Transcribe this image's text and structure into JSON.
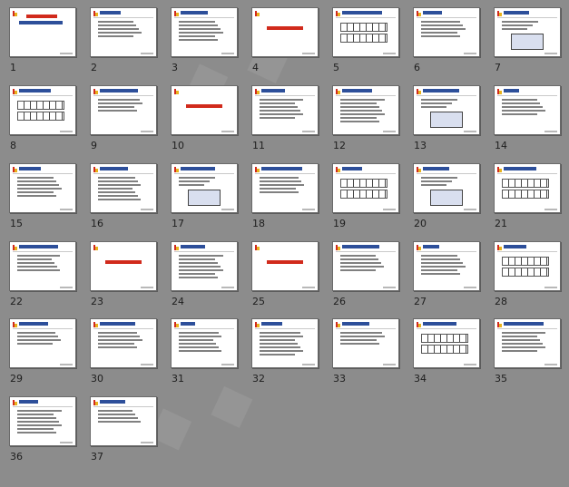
{
  "slides": [
    {
      "number": "1",
      "kind": "cover"
    },
    {
      "number": "2",
      "kind": "text"
    },
    {
      "number": "3",
      "kind": "text"
    },
    {
      "number": "4",
      "kind": "section"
    },
    {
      "number": "5",
      "kind": "table"
    },
    {
      "number": "6",
      "kind": "text"
    },
    {
      "number": "7",
      "kind": "image"
    },
    {
      "number": "8",
      "kind": "table"
    },
    {
      "number": "9",
      "kind": "text"
    },
    {
      "number": "10",
      "kind": "section"
    },
    {
      "number": "11",
      "kind": "text"
    },
    {
      "number": "12",
      "kind": "text"
    },
    {
      "number": "13",
      "kind": "image"
    },
    {
      "number": "14",
      "kind": "text"
    },
    {
      "number": "15",
      "kind": "text"
    },
    {
      "number": "16",
      "kind": "text"
    },
    {
      "number": "17",
      "kind": "image"
    },
    {
      "number": "18",
      "kind": "text"
    },
    {
      "number": "19",
      "kind": "table"
    },
    {
      "number": "20",
      "kind": "image"
    },
    {
      "number": "21",
      "kind": "table"
    },
    {
      "number": "22",
      "kind": "text"
    },
    {
      "number": "23",
      "kind": "section"
    },
    {
      "number": "24",
      "kind": "text"
    },
    {
      "number": "25",
      "kind": "section"
    },
    {
      "number": "26",
      "kind": "text"
    },
    {
      "number": "27",
      "kind": "text"
    },
    {
      "number": "28",
      "kind": "table"
    },
    {
      "number": "29",
      "kind": "text"
    },
    {
      "number": "30",
      "kind": "text"
    },
    {
      "number": "31",
      "kind": "text"
    },
    {
      "number": "32",
      "kind": "text"
    },
    {
      "number": "33",
      "kind": "text"
    },
    {
      "number": "34",
      "kind": "table"
    },
    {
      "number": "35",
      "kind": "text"
    },
    {
      "number": "36",
      "kind": "text"
    },
    {
      "number": "37",
      "kind": "text"
    }
  ],
  "colors": {
    "background": "#8c8c8c",
    "slide": "#ffffff",
    "accent_red": "#d12a1c",
    "accent_yellow": "#e8b21c",
    "title_blue": "#2d4f9a"
  }
}
